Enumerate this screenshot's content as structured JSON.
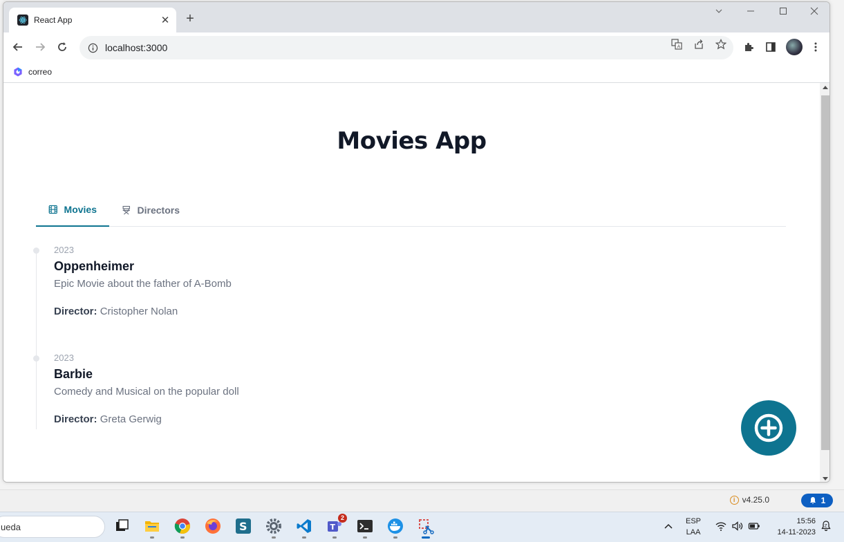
{
  "browser": {
    "tab_title": "React App",
    "tab_close": "✕",
    "new_tab": "+",
    "url": "localhost:3000",
    "bookmark_label": "correo"
  },
  "app": {
    "title": "Movies App",
    "accent_color": "#0e7490",
    "tabs": [
      {
        "label": "Movies",
        "icon": "film-icon",
        "active": true
      },
      {
        "label": "Directors",
        "icon": "director-chair-icon",
        "active": false
      }
    ],
    "director_label": "Director:",
    "movies": [
      {
        "year": "2023",
        "title": "Oppenheimer",
        "description": "Epic Movie about the father of A-Bomb",
        "director": "Cristopher Nolan"
      },
      {
        "year": "2023",
        "title": "Barbie",
        "description": "Comedy and Musical on the popular doll",
        "director": "Greta Gerwig"
      }
    ],
    "fab_icon": "plus-circle-icon"
  },
  "background_app": {
    "version": "v4.25.0",
    "notifications": "1"
  },
  "taskbar": {
    "search_text": "ueda",
    "teams_badge": "2",
    "lang_line1": "ESP",
    "lang_line2": "LAA",
    "time": "15:56",
    "date": "14-11-2023"
  }
}
